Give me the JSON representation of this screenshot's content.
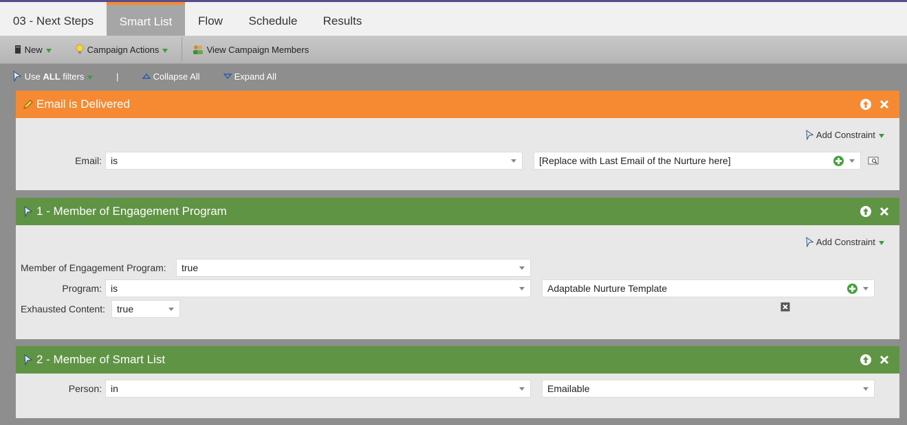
{
  "tabs": [
    "03 - Next Steps",
    "Smart List",
    "Flow",
    "Schedule",
    "Results"
  ],
  "toolbar": {
    "new_label": "New",
    "campaign_actions_label": "Campaign Actions",
    "view_members_label": "View Campaign Members"
  },
  "filterbar": {
    "use_prefix": "Use",
    "use_all": "ALL",
    "use_suffix": "filters",
    "separator": "|",
    "collapse_label": "Collapse All",
    "expand_label": "Expand All"
  },
  "colors": {
    "orange": "#f68a33",
    "green": "#5f9444",
    "accent": "#5a4d8c"
  },
  "add_constraint_label": "Add Constraint",
  "filters": [
    {
      "title": "Email is Delivered",
      "email_label": "Email:",
      "email_operator": "is",
      "email_value": "[Replace with Last Email of the Nurture here]"
    },
    {
      "title": "1 - Member of Engagement Program",
      "member_label": "Member of Engagement Program:",
      "member_value": "true",
      "program_label": "Program:",
      "program_operator": "is",
      "program_value": "Adaptable Nurture Template",
      "exhausted_label": "Exhausted Content:",
      "exhausted_value": "true"
    },
    {
      "title": "2 - Member of Smart List",
      "person_label": "Person:",
      "person_operator": "in",
      "person_value": "Emailable"
    }
  ]
}
